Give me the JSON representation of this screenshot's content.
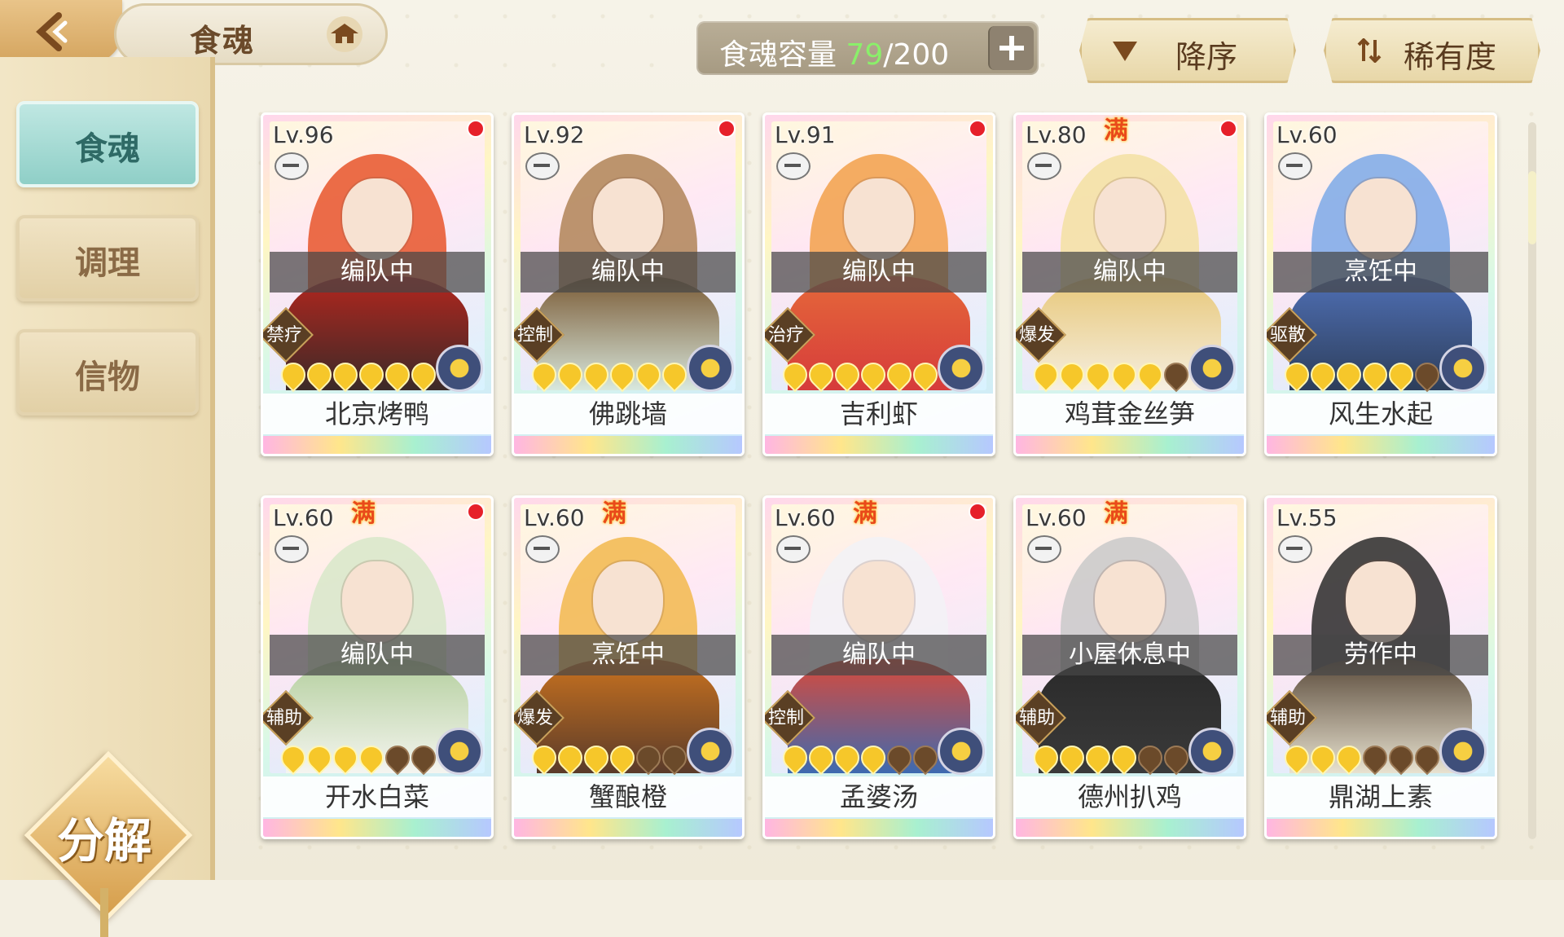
{
  "header": {
    "title": "食魂",
    "capacity_label": "食魂容量",
    "capacity_current": "79",
    "capacity_total": "/200",
    "sort_order": "降序",
    "sort_by": "稀有度"
  },
  "sidebar": {
    "items": [
      {
        "label": "食魂",
        "active": true
      },
      {
        "label": "调理",
        "active": false
      },
      {
        "label": "信物",
        "active": false
      }
    ],
    "decompose": "分解"
  },
  "cards": [
    {
      "level": "Lv.96",
      "max": "",
      "status": "编队中",
      "role": "禁疗",
      "stars_on": 6,
      "stars_total": 6,
      "name": "北京烤鸭",
      "red_dot": true
    },
    {
      "level": "Lv.92",
      "max": "",
      "status": "编队中",
      "role": "控制",
      "stars_on": 6,
      "stars_total": 6,
      "name": "佛跳墙",
      "red_dot": true
    },
    {
      "level": "Lv.91",
      "max": "",
      "status": "编队中",
      "role": "治疗",
      "stars_on": 6,
      "stars_total": 6,
      "name": "吉利虾",
      "red_dot": true
    },
    {
      "level": "Lv.80",
      "max": "满",
      "status": "编队中",
      "role": "爆发",
      "stars_on": 5,
      "stars_total": 6,
      "name": "鸡茸金丝笋",
      "red_dot": true
    },
    {
      "level": "Lv.60",
      "max": "",
      "status": "烹饪中",
      "role": "驱散",
      "stars_on": 5,
      "stars_total": 6,
      "name": "风生水起",
      "red_dot": false
    },
    {
      "level": "Lv.60",
      "max": "满",
      "status": "编队中",
      "role": "辅助",
      "stars_on": 4,
      "stars_total": 6,
      "name": "开水白菜",
      "red_dot": true
    },
    {
      "level": "Lv.60",
      "max": "满",
      "status": "烹饪中",
      "role": "爆发",
      "stars_on": 4,
      "stars_total": 6,
      "name": "蟹酿橙",
      "red_dot": false
    },
    {
      "level": "Lv.60",
      "max": "满",
      "status": "编队中",
      "role": "控制",
      "stars_on": 4,
      "stars_total": 6,
      "name": "孟婆汤",
      "red_dot": true
    },
    {
      "level": "Lv.60",
      "max": "满",
      "status": "小屋休息中",
      "role": "辅助",
      "stars_on": 4,
      "stars_total": 6,
      "name": "德州扒鸡",
      "red_dot": false
    },
    {
      "level": "Lv.55",
      "max": "",
      "status": "劳作中",
      "role": "辅助",
      "stars_on": 3,
      "stars_total": 6,
      "name": "鼎湖上素",
      "red_dot": false
    }
  ]
}
